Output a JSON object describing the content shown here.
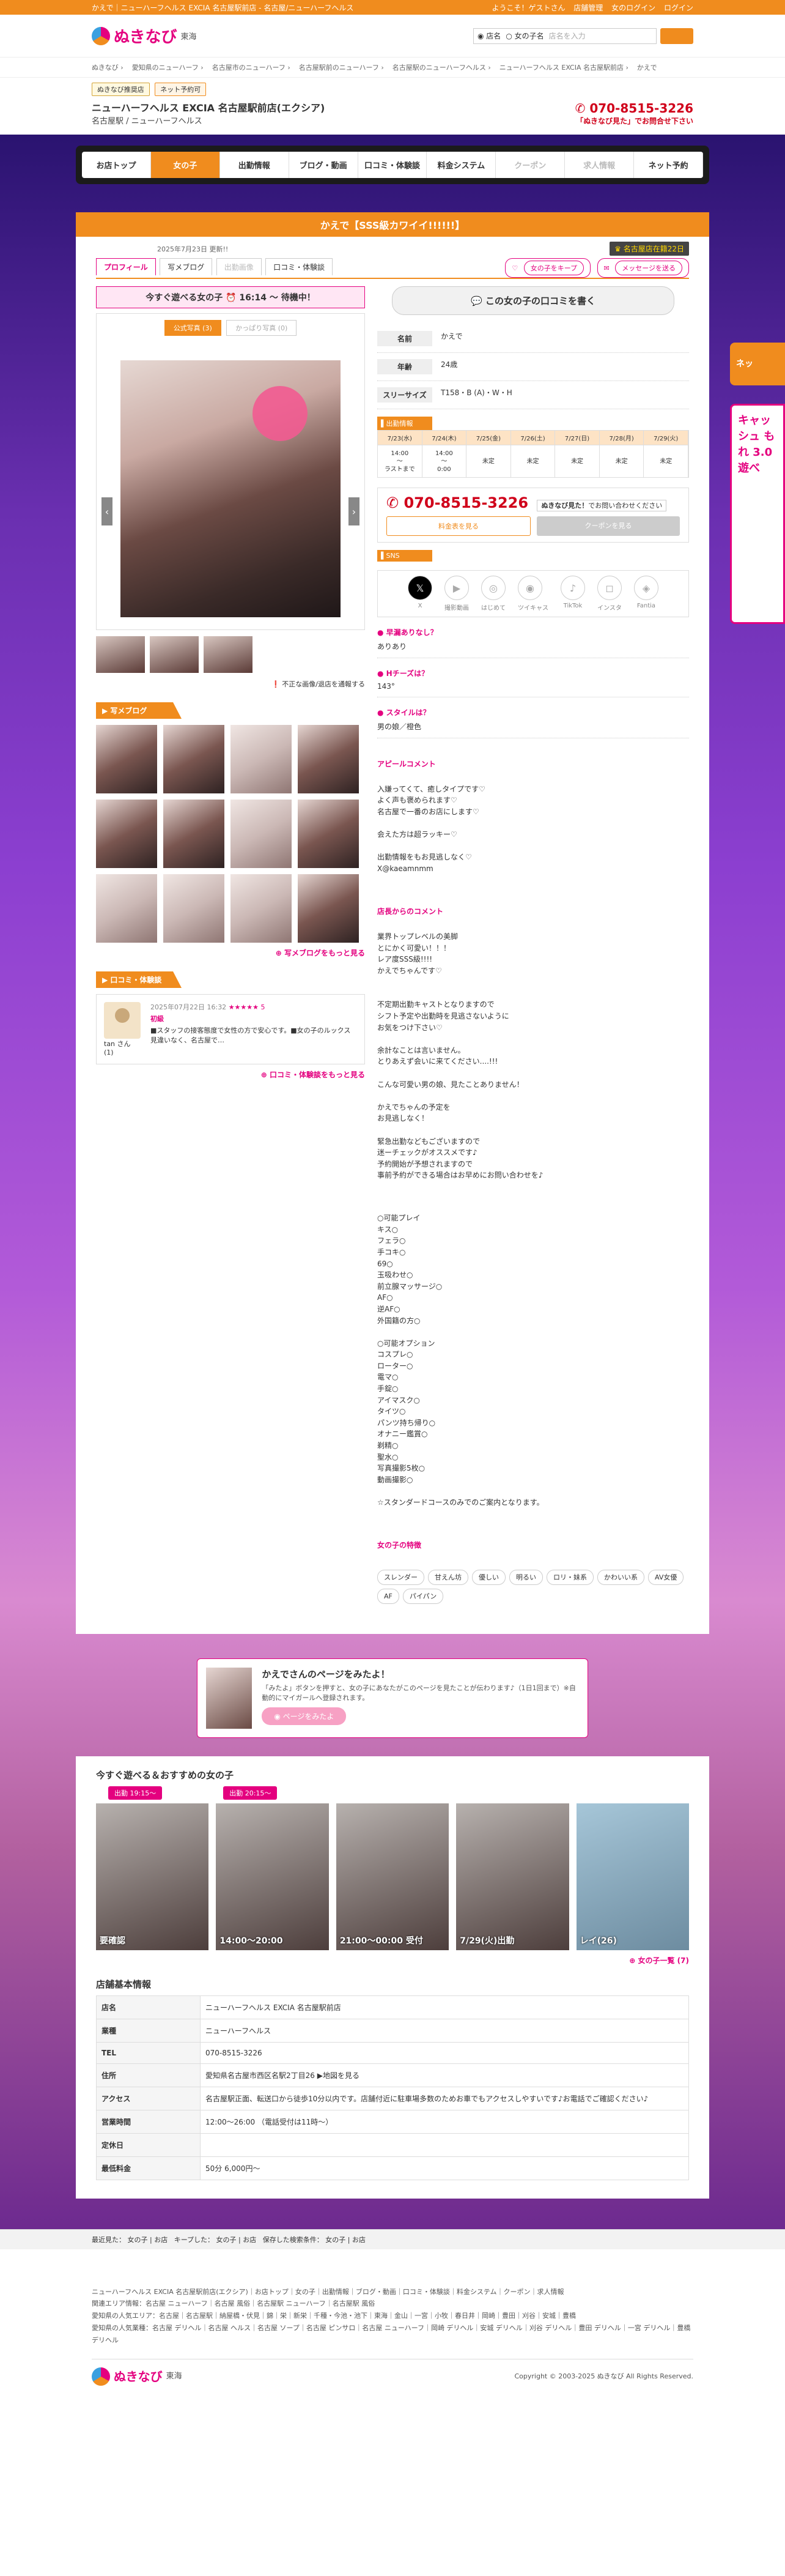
{
  "topbar": {
    "left": "かえで｜ニューハーフヘルス EXCIA 名古屋駅前店 - 名古屋/ニューハーフヘルス",
    "greet": "ようこそ！ゲストさん",
    "link1": "店舗管理",
    "link2": "女のログイン",
    "link3": "ログイン"
  },
  "logo": {
    "name": "ぬきなび",
    "region": "東海"
  },
  "search": {
    "opt1": "店名",
    "opt2": "女の子名",
    "placeholder": "店名を入力"
  },
  "crumbs": [
    "ぬきなび",
    "愛知県のニューハーフ",
    "名古屋市のニューハーフ",
    "名古屋駅前のニューハーフ",
    "名古屋駅のニューハーフヘルス",
    "ニューハーフヘルス EXCIA 名古屋駅前店",
    "かえで"
  ],
  "shop": {
    "tag1": "ぬきなび推奨店",
    "tag2": "ネット予約可",
    "name": "ニューハーフヘルス EXCIA 名古屋駅前店(エクシア)",
    "sub": "名古屋駅 / ニューハーフヘルス",
    "tel": "070-8515-3226",
    "telnote": "「ぬきなび見た」でお問合せ下さい"
  },
  "nav": [
    "お店トップ",
    "女の子",
    "出勤情報",
    "ブログ・動画",
    "口コミ・体験談",
    "料金システム",
    "クーポン",
    "求人情報",
    "ネット予約"
  ],
  "girl": {
    "title": "かえで【SSS級カワイイ!!!!!!】",
    "date": "2025年7月23日 更新!!",
    "badge": "名古屋店在籍22日"
  },
  "tabs": [
    "プロフィール",
    "写メブログ",
    "出勤画像",
    "口コミ・体験談"
  ],
  "tabs_right": [
    "女の子をキープ",
    "メッセージを送る"
  ],
  "nowbar": "今すぐ遊べる女の子 ⏰ 16:14 〜 待機中！",
  "photo_tabs": [
    "公式写真 (3)",
    "かっぱり写真 (0)"
  ],
  "note": "不正な画像/退店を通報する",
  "blog_head": "写メブログ",
  "blog_more": "写メブログをもっと見る",
  "review": {
    "head": "口コミ・体験談",
    "date": "2025年07月22日 16:32",
    "stars": "★★★★★ 5",
    "title": "初級",
    "text": "■スタッフの接客態度で女性の方で安心です。■女の子のルックス見違いなく、名古屋で…",
    "user": "tan さん (1)",
    "more": "口コミ・体験談をもっと見る"
  },
  "write_btn": "この女の子の口コミを書く",
  "profile": [
    {
      "k": "名前",
      "v": "かえで"
    },
    {
      "k": "年齢",
      "v": "24歳"
    },
    {
      "k": "スリーサイズ",
      "v": "T158・B (A)・W・H"
    }
  ],
  "sched_head": "出勤情報",
  "sched": [
    {
      "d": "7/23(水)",
      "v": "14:00\n〜\nラストまで"
    },
    {
      "d": "7/24(木)",
      "v": "14:00\n〜\n0:00"
    },
    {
      "d": "7/25(金)",
      "v": "未定"
    },
    {
      "d": "7/26(土)",
      "v": "未定"
    },
    {
      "d": "7/27(日)",
      "v": "未定"
    },
    {
      "d": "7/28(月)",
      "v": "未定"
    },
    {
      "d": "7/29(火)",
      "v": "未定"
    }
  ],
  "telbox": {
    "tel": "070-8515-3226",
    "note": "ぬきなび見た！",
    "note2": "でお問い合わせください",
    "btn1": "料金表を見る",
    "btn2": "クーポンを見る"
  },
  "sns": {
    "head": "SNS",
    "items": [
      "X",
      "撮影動画",
      "はじめて",
      "ツイキャス",
      "TikTok",
      "インスタ",
      "Fantia"
    ]
  },
  "qa": [
    {
      "q": "早漏ありなし？",
      "a": "ありあり"
    },
    {
      "q": "Hチーズは？",
      "a": "143°"
    },
    {
      "q": "スタイルは？",
      "a": "男の娘／橙色"
    }
  ],
  "appeal": {
    "q": "アピールコメント",
    "text": "入嫌ってくて、癒しタイプです♡\nよく声も褒められます♡\n名古屋で一番のお店にします♡\n\n会えた方は超ラッキー♡\n\n出勤情報をもお見逃しなく♡\nX@kaeamnmm"
  },
  "staff": {
    "q": "店長からのコメント",
    "text": "業界トップレベルの美脚\nとにかく可愛い！！！\nレア度SSS級!!!!\nかえでちゃんです♡\n\n\n不定期出勤キャストとなりますので\nシフト予定や出勤時を見逃さないように\nお気をつけ下さい♡\n\n余計なことは言いません。\nとりあえず会いに来てください....!!!\n\nこんな可愛い男の娘、見たことありません！\n\nかえでちゃんの予定を\nお見逃しなく！\n\n緊急出勤などもございますので\n迷ーチェックがオススメです♪\n予約開始が予想されますので\n事前予約ができる場合はお早めにお問い合わせを♪"
  },
  "play": {
    "text": "○可能プレイ\nキス○\nフェラ○\n手コキ○\n69○\n玉吸わせ○\n前立腺マッサージ○\nAF○\n逆AF○\n外国籍の方○\n\n○可能オプション\nコスプレ○\nローター○\n電マ○\n手錠○\nアイマスク○\nタイツ○\nパンツ持ち帰り○\nオナニー鑑賞○\n剃精○\n聖水○\n写真撮影5枚○\n動画撮影○\n\n☆スタンダードコースのみでのご案内となります。"
  },
  "type_head": "女の子の特徴",
  "types": [
    "スレンダー",
    "甘えん坊",
    "優しい",
    "明るい",
    "ロリ・妹系",
    "かわいい系",
    "AV女優",
    "AF",
    "パイパン"
  ],
  "banner": {
    "title": "かえでさんのページをみたよ！",
    "sub": "「みたよ」ボタンを押すと、女の子にあなたがこのページを見たことが伝わります♪（1日1回まで）※自動的にマイガールへ登録されます。",
    "btn": "ページをみたよ"
  },
  "recs": {
    "head": "今すぐ遊べる＆おすすめの女の子",
    "tag1": "出勤 19:15〜",
    "tag2": "出勤 20:15〜",
    "items": [
      "要確認",
      "14:00〜20:00",
      "21:00〜00:00 受付",
      "7/29(火)出勤",
      "レイ(26)"
    ],
    "more": "女の子一覧 (7)"
  },
  "info": {
    "head": "店舗基本情報",
    "rows": [
      {
        "k": "店名",
        "v": "ニューハーフヘルス EXCIA 名古屋駅前店"
      },
      {
        "k": "業種",
        "v": "ニューハーフヘルス"
      },
      {
        "k": "TEL",
        "v": "070-8515-3226"
      },
      {
        "k": "住所",
        "v": "愛知県名古屋市西区名駅2丁目26 ▶地図を見る"
      },
      {
        "k": "アクセス",
        "v": "名古屋駅正面、転送口から徒歩10分以内です。店舗付近に駐車場多数のためお車でもアクセスしやすいです♪お電話でご確認ください♪"
      },
      {
        "k": "営業時間",
        "v": "12:00〜26:00 （電話受付は11時〜）"
      },
      {
        "k": "定休日",
        "v": ""
      },
      {
        "k": "最低料金",
        "v": "50分 6,000円〜"
      }
    ]
  },
  "footbar": {
    "label1": "最近見た：",
    "v1": "女の子",
    "v1b": "お店",
    "label2": "キープした：",
    "v2": "女の子",
    "v2b": "お店",
    "label3": "保存した検索条件：",
    "v3": "女の子",
    "v3b": "お店"
  },
  "footer": {
    "line1": "ニューハーフヘルス EXCIA 名古屋駅前店(エクシア)｜お店トップ｜女の子｜出勤情報｜ブログ・動画｜口コミ・体験談｜料金システム｜クーポン｜求人情報",
    "line2": "関連エリア情報：名古屋 ニューハーフ｜名古屋 風俗｜名古屋駅 ニューハーフ｜名古屋駅 風俗",
    "line3": "愛知県の人気エリア：名古屋｜名古屋駅｜納屋橋・伏見｜錦｜栄｜新栄｜千種・今池・池下｜東海｜金山｜一宮｜小牧｜春日井｜岡崎｜豊田｜刈谷｜安城｜豊橋",
    "line4": "愛知県の人気業種：名古屋 デリヘル｜名古屋 ヘルス｜名古屋 ソープ｜名古屋 ピンサロ｜名古屋 ニューハーフ｜岡崎 デリヘル｜安城 デリヘル｜刈谷 デリヘル｜豊田 デリヘル｜一宮 デリヘル｜豊橋 デリヘル",
    "copy": "Copyright © 2003-2025 ぬきなび All Rights Reserved."
  },
  "side": {
    "s1": "ネッ",
    "s2": "キャッシュ もれ 3.0 遊べ"
  }
}
